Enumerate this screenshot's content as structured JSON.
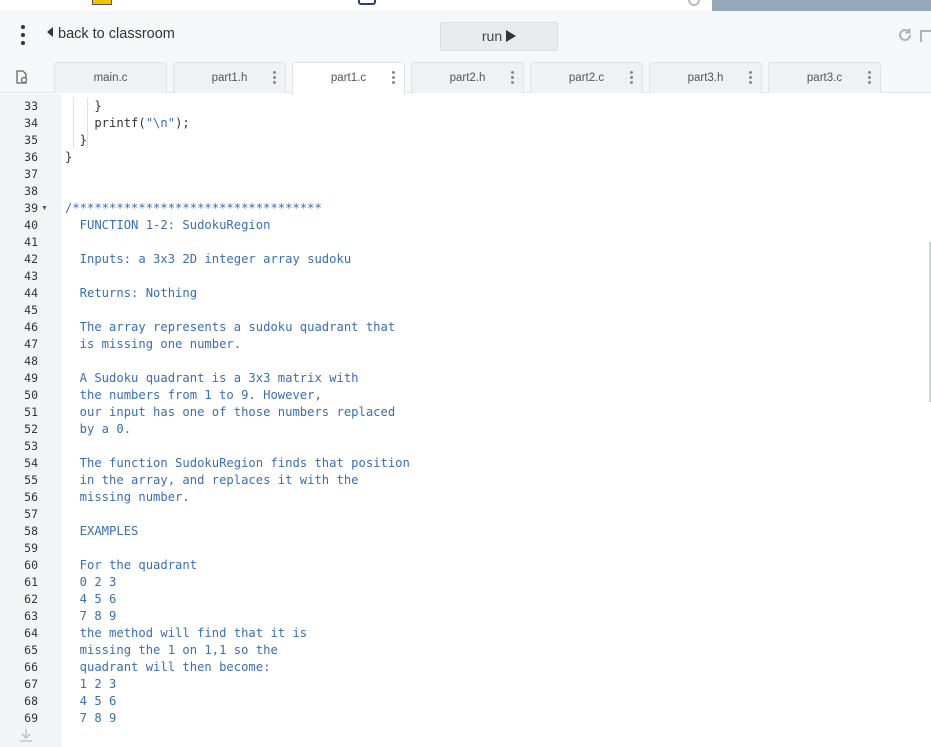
{
  "toolbar": {
    "back_label": "back to classroom",
    "run_label": "run"
  },
  "tabs": [
    {
      "label": "main.c",
      "active": false,
      "menu": false
    },
    {
      "label": "part1.h",
      "active": false,
      "menu": true
    },
    {
      "label": "part1.c",
      "active": true,
      "menu": true
    },
    {
      "label": "part2.h",
      "active": false,
      "menu": true
    },
    {
      "label": "part2.c",
      "active": false,
      "menu": true
    },
    {
      "label": "part3.h",
      "active": false,
      "menu": true
    },
    {
      "label": "part3.c",
      "active": false,
      "menu": true
    }
  ],
  "editor": {
    "lines": [
      {
        "n": "33",
        "text": "    }",
        "kind": "code"
      },
      {
        "n": "34",
        "text": "    printf(\"\\n\");",
        "kind": "printf"
      },
      {
        "n": "35",
        "text": "  }",
        "kind": "code"
      },
      {
        "n": "36",
        "text": "}",
        "kind": "code"
      },
      {
        "n": "37",
        "text": "",
        "kind": "code"
      },
      {
        "n": "38",
        "text": "",
        "kind": "code"
      },
      {
        "n": "39",
        "text": "/**********************************",
        "kind": "cmt",
        "fold": true
      },
      {
        "n": "40",
        "text": "  FUNCTION 1-2: SudokuRegion",
        "kind": "cmt"
      },
      {
        "n": "41",
        "text": "",
        "kind": "cmt"
      },
      {
        "n": "42",
        "text": "  Inputs: a 3x3 2D integer array sudoku",
        "kind": "cmt"
      },
      {
        "n": "43",
        "text": "",
        "kind": "cmt"
      },
      {
        "n": "44",
        "text": "  Returns: Nothing",
        "kind": "cmt"
      },
      {
        "n": "45",
        "text": "",
        "kind": "cmt"
      },
      {
        "n": "46",
        "text": "  The array represents a sudoku quadrant that",
        "kind": "cmt"
      },
      {
        "n": "47",
        "text": "  is missing one number.",
        "kind": "cmt"
      },
      {
        "n": "48",
        "text": "",
        "kind": "cmt"
      },
      {
        "n": "49",
        "text": "  A Sudoku quadrant is a 3x3 matrix with",
        "kind": "cmt"
      },
      {
        "n": "50",
        "text": "  the numbers from 1 to 9. However,",
        "kind": "cmt"
      },
      {
        "n": "51",
        "text": "  our input has one of those numbers replaced",
        "kind": "cmt"
      },
      {
        "n": "52",
        "text": "  by a 0.",
        "kind": "cmt"
      },
      {
        "n": "53",
        "text": "",
        "kind": "cmt"
      },
      {
        "n": "54",
        "text": "  The function SudokuRegion finds that position",
        "kind": "cmt"
      },
      {
        "n": "55",
        "text": "  in the array, and replaces it with the",
        "kind": "cmt"
      },
      {
        "n": "56",
        "text": "  missing number.",
        "kind": "cmt"
      },
      {
        "n": "57",
        "text": "",
        "kind": "cmt"
      },
      {
        "n": "58",
        "text": "  EXAMPLES",
        "kind": "cmt"
      },
      {
        "n": "59",
        "text": "",
        "kind": "cmt"
      },
      {
        "n": "60",
        "text": "  For the quadrant",
        "kind": "cmt"
      },
      {
        "n": "61",
        "text": "  0 2 3",
        "kind": "cmt"
      },
      {
        "n": "62",
        "text": "  4 5 6",
        "kind": "cmt"
      },
      {
        "n": "63",
        "text": "  7 8 9",
        "kind": "cmt"
      },
      {
        "n": "64",
        "text": "  the method will find that it is",
        "kind": "cmt"
      },
      {
        "n": "65",
        "text": "  missing the 1 on 1,1 so the",
        "kind": "cmt"
      },
      {
        "n": "66",
        "text": "  quadrant will then become:",
        "kind": "cmt"
      },
      {
        "n": "67",
        "text": "  1 2 3",
        "kind": "cmt"
      },
      {
        "n": "68",
        "text": "  4 5 6",
        "kind": "cmt"
      },
      {
        "n": "69",
        "text": "  7 8 9",
        "kind": "cmt"
      }
    ]
  }
}
